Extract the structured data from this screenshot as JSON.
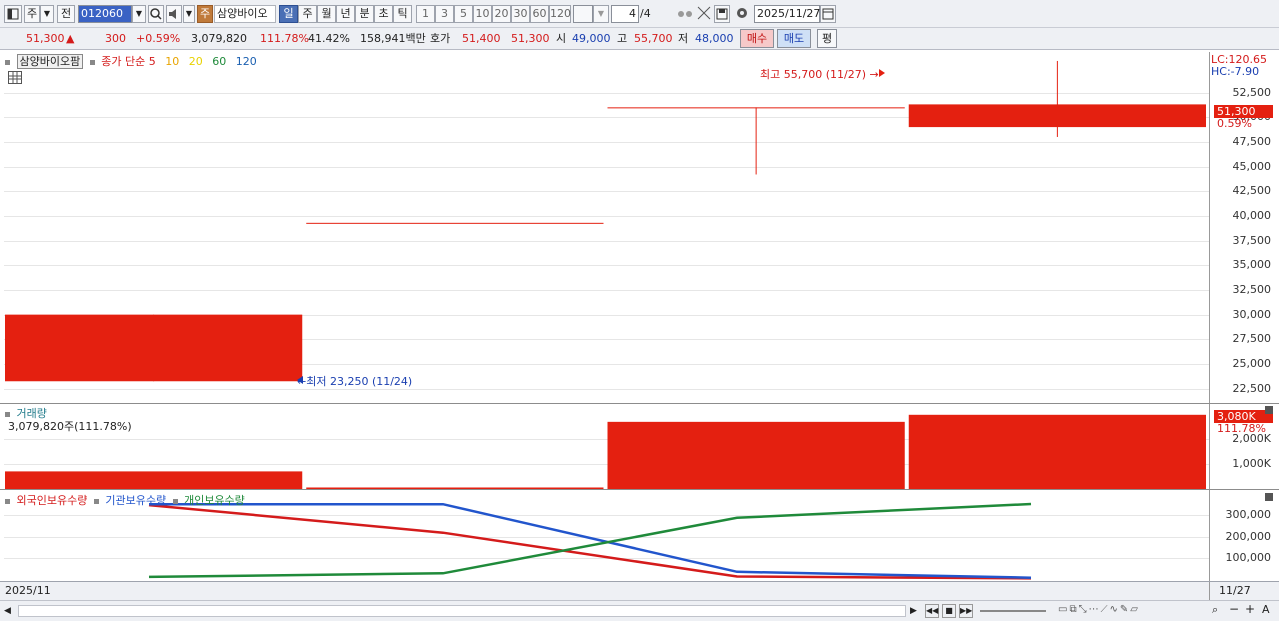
{
  "toolbar": {
    "period_label": "주",
    "prev_label": "전",
    "code": "012060",
    "stock_name_badge": "주",
    "stock_name": "삼양바이오",
    "periods": [
      "일",
      "주",
      "월",
      "년",
      "분",
      "초",
      "틱"
    ],
    "selected_period": "일",
    "intervals": [
      "1",
      "3",
      "5",
      "10",
      "20",
      "30",
      "60",
      "120"
    ],
    "page_value": "4",
    "page_total": "/4",
    "date": "2025/11/27"
  },
  "quote": {
    "price": "51,300",
    "arrow": "▲",
    "change": "300",
    "change_pct": "+0.59%",
    "volume": "3,079,820",
    "volume_ratio": "111.78%",
    "turnover": "41.42%",
    "amount": "158,941백만",
    "ask_label": "호가",
    "ask1": "51,400",
    "ask2": "51,300",
    "open_label": "시",
    "open": "49,000",
    "high_label": "고",
    "high": "55,700",
    "low_label": "저",
    "low": "48,000",
    "buy_label": "매수",
    "sell_label": "매도",
    "eval_label": "평"
  },
  "price_panel": {
    "stock_tag": "삼양바이오팜",
    "legend_prefix": "종가 단순",
    "ma": [
      {
        "label": "5",
        "color": "#d41b1b"
      },
      {
        "label": "10",
        "color": "#e8a400"
      },
      {
        "label": "20",
        "color": "#e8d200"
      },
      {
        "label": "60",
        "color": "#1f8a3a"
      },
      {
        "label": "120",
        "color": "#1a5fb0"
      }
    ],
    "lc_label": "LC:120.65",
    "hc_label": "HC:-7.90",
    "y_ticks": [
      "52,500",
      "50,000",
      "47,500",
      "45,000",
      "42,500",
      "40,000",
      "37,500",
      "35,000",
      "32,500",
      "30,000",
      "27,500",
      "25,000",
      "22,500"
    ],
    "current_price_tag": "51,300",
    "current_pct_tag": "0.59%",
    "high_annotation": "최고 55,700 (11/27) →",
    "low_annotation": "←최저 23,250 (11/24)"
  },
  "volume_panel": {
    "title": "거래량",
    "value_text": "3,079,820주(111.78%)",
    "tag_value": "3,080K",
    "tag_pct": "111.78%",
    "y_ticks": [
      "2,000K",
      "1,000K"
    ]
  },
  "holding_panel": {
    "legend": [
      {
        "label": "외국인보유수량",
        "color": "#d41b1b"
      },
      {
        "label": "기관보유수량",
        "color": "#2255cc"
      },
      {
        "label": "개인보유수량",
        "color": "#1f8a3a"
      }
    ],
    "y_ticks": [
      "300,000",
      "200,000",
      "100,000"
    ]
  },
  "bottom_axis": {
    "left_label": "2025/11",
    "right_label": "11/27"
  },
  "chart_data": [
    {
      "type": "candlestick",
      "title": "",
      "ylim": [
        21250,
        56000
      ],
      "candles": [
        {
          "open": 30000,
          "close": 23250,
          "high": 30000,
          "low": 23250
        },
        {
          "open": 39300,
          "close": 39300,
          "high": 39300,
          "low": 39300
        },
        {
          "open": 51000,
          "close": 51000,
          "high": 51000,
          "low": 44200
        },
        {
          "open": 49000,
          "close": 51300,
          "high": 55700,
          "low": 48000
        }
      ]
    },
    {
      "type": "bar",
      "title": "거래량",
      "ylim": [
        0,
        3300
      ],
      "unit": "K",
      "values": [
        700,
        60,
        2670,
        2950
      ]
    },
    {
      "type": "line",
      "ylim": [
        0,
        400000
      ],
      "series": [
        {
          "name": "외국인보유수량",
          "color": "#d41b1b",
          "values": [
            348000,
            218000,
            12000,
            3000
          ]
        },
        {
          "name": "기관보유수량",
          "color": "#2255cc",
          "values": [
            352000,
            352000,
            34000,
            6000
          ]
        },
        {
          "name": "개인보유수량",
          "color": "#1f8a3a",
          "values": [
            10000,
            27000,
            288000,
            353000
          ]
        }
      ]
    }
  ]
}
